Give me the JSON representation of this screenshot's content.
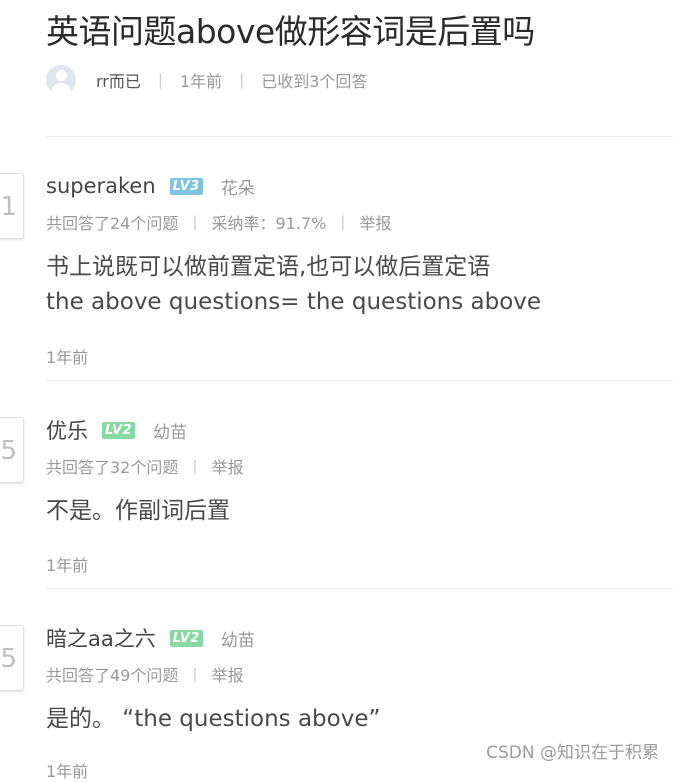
{
  "question": {
    "title": "英语问题above做形容词是后置吗",
    "asker": "rr而已",
    "time": "1年前",
    "answer_count": "已收到3个回答"
  },
  "answers": [
    {
      "avatar_glyph": "1",
      "name": "superaken",
      "level": "LV3",
      "level_color": "#7fc3e3",
      "rank": "花朵",
      "answered": "共回答了24个问题",
      "adoption": "采纳率：91.7%",
      "report": "举报",
      "lines": [
        "书上说既可以做前置定语,也可以做后置定语",
        "the above questions= the questions above"
      ],
      "time": "1年前"
    },
    {
      "avatar_glyph": "5",
      "name": "优乐",
      "level": "LV2",
      "level_color": "#86d9a2",
      "rank": "幼苗",
      "answered": "共回答了32个问题",
      "report": "举报",
      "lines": [
        "不是。作副词后置"
      ],
      "time": "1年前"
    },
    {
      "avatar_glyph": "5",
      "name": "暗之aa之六",
      "level": "LV2",
      "level_color": "#86d9a2",
      "rank": "幼苗",
      "answered": "共回答了49个问题",
      "report": "举报",
      "lines": [
        "是的。 “the questions above”"
      ],
      "time": "1年前"
    }
  ],
  "watermark": "CSDN @知识在于积累"
}
